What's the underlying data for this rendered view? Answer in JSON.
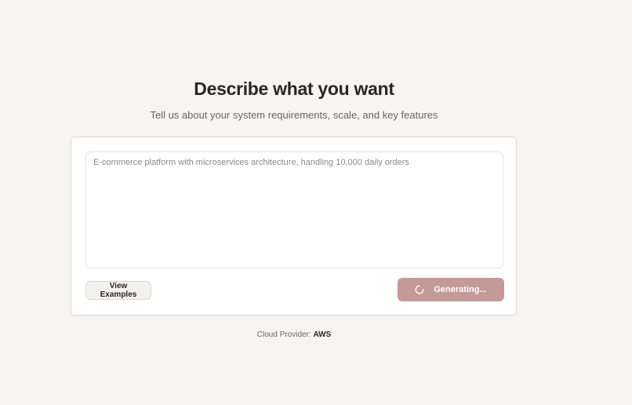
{
  "header": {
    "title": "Describe what you want",
    "subtitle": "Tell us about your system requirements, scale, and key features"
  },
  "form": {
    "textarea_value": "",
    "textarea_placeholder": "E-commerce platform with microservices architecture, handling 10,000 daily orders",
    "examples_label": "View Examples",
    "generate_label": "Generating...",
    "generate_icon": "spinner-icon",
    "generating": true
  },
  "footer": {
    "provider_label": "Cloud Provider:",
    "provider_value": "AWS"
  },
  "colors": {
    "background": "#f6f5f3",
    "accent_disabled": "#c49a99",
    "text": "#2a2623",
    "muted": "#6f6461"
  }
}
